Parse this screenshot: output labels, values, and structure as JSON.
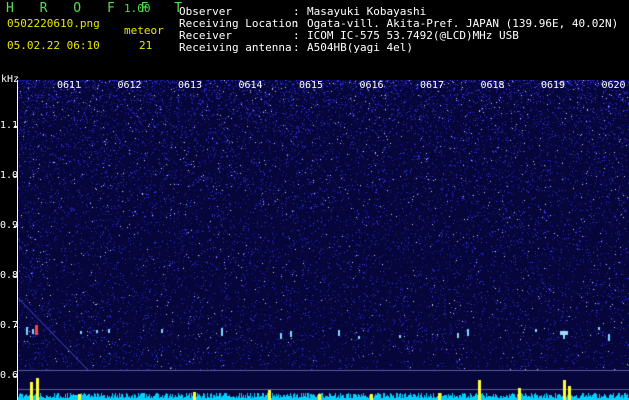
{
  "app": {
    "name": "H R O F F T",
    "version": "1.00",
    "filename": "0502220610.png",
    "datetime": "05.02.22 06:10",
    "meteor_label": "meteor",
    "meteor_count": "21"
  },
  "info": {
    "observer_label": "Observer",
    "observer_value": "Masayuki Kobayashi",
    "location_label": "Receiving Location",
    "location_value": "Ogata-vill. Akita-Pref. JAPAN (139.96E, 40.02N)",
    "receiver_label": "Receiver",
    "receiver_value": "ICOM IC-575 53.7492(@LCD)MHz USB",
    "antenna_label": "Receiving antenna",
    "antenna_value": "A504HB(yagi 4el)",
    "separator": ":"
  },
  "spectrogram": {
    "y_unit": "kHz",
    "y_ticks": [
      "1.1",
      "1.0",
      "0.9",
      "0.8",
      "0.7",
      "0.6"
    ],
    "x_ticks": [
      "0611",
      "0612",
      "0613",
      "0614",
      "0615",
      "0616",
      "0617",
      "0618",
      "0619",
      "0620"
    ],
    "colors": {
      "background": "#06063a",
      "noise": "#3a3aff",
      "echo": "#7fd8ff",
      "strong": "#ff4040",
      "baseline": "#00d0ff",
      "spike": "#ffff33"
    }
  }
}
